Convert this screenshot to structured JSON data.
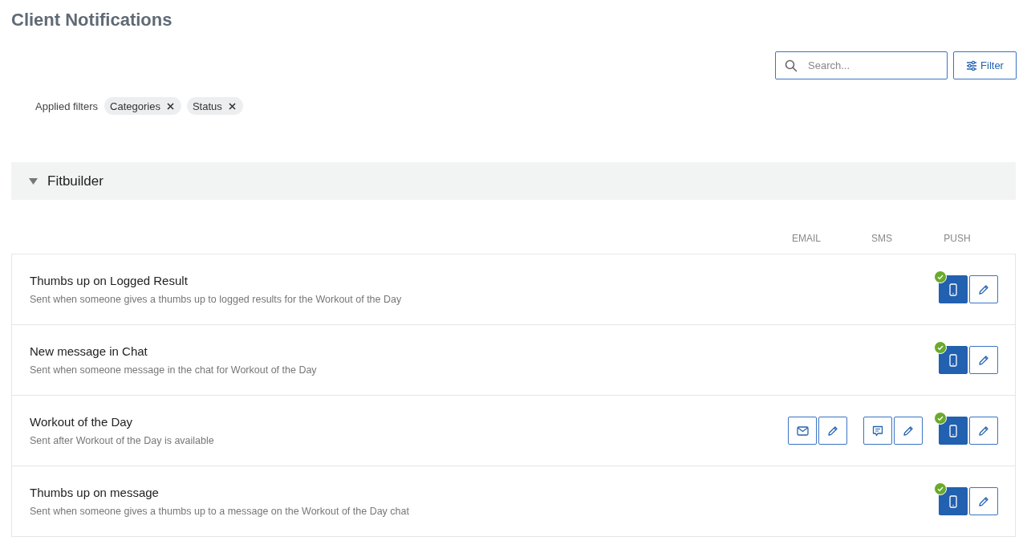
{
  "title": "Client Notifications",
  "search": {
    "placeholder": "Search..."
  },
  "filter_button": "Filter",
  "applied_filters": {
    "label": "Applied filters",
    "chips": [
      "Categories",
      "Status"
    ]
  },
  "group": {
    "name": "Fitbuilder",
    "expanded": true,
    "columns": [
      "EMAIL",
      "SMS",
      "PUSH"
    ],
    "notifications": [
      {
        "title": "Thumbs up on Logged Result",
        "description": "Sent when someone gives a thumbs up to logged results for the Workout of the Day",
        "channels": [
          {
            "kind": "push",
            "enabled": true
          }
        ]
      },
      {
        "title": "New message in Chat",
        "description": "Sent when someone message in the chat for Workout of the Day",
        "channels": [
          {
            "kind": "push",
            "enabled": true
          }
        ]
      },
      {
        "title": "Workout of the Day",
        "description": "Sent after Workout of the Day is available",
        "channels": [
          {
            "kind": "email",
            "enabled": false
          },
          {
            "kind": "sms",
            "enabled": false
          },
          {
            "kind": "push",
            "enabled": true
          }
        ]
      },
      {
        "title": "Thumbs up on message",
        "description": "Sent when someone gives a thumbs up to a message on the Workout of the Day chat",
        "channels": [
          {
            "kind": "push",
            "enabled": true
          }
        ]
      }
    ]
  }
}
